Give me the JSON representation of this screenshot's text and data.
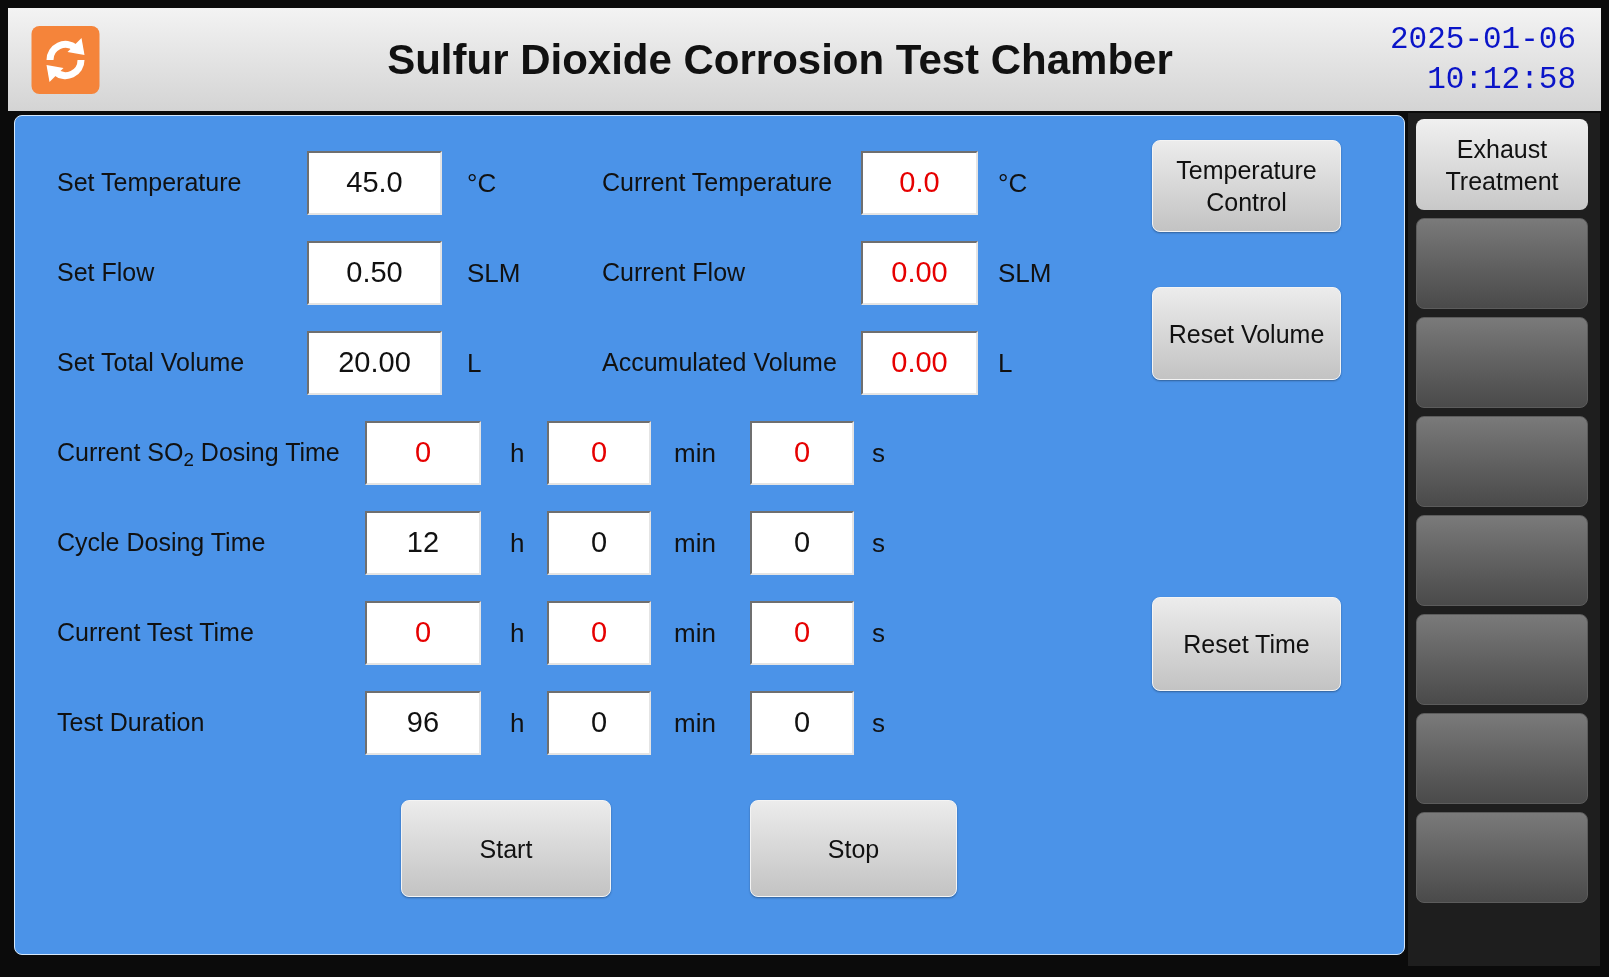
{
  "header": {
    "title": "Sulfur Dioxide Corrosion Test Chamber",
    "date": "2025-01-06",
    "time": "10:12:58"
  },
  "parameter_rows": [
    {
      "setpoint": {
        "label": "Set Temperature",
        "value": "45.0",
        "unit": "°C"
      },
      "reading": {
        "label": "Current Temperature",
        "value": "0.0",
        "unit": "°C"
      }
    },
    {
      "setpoint": {
        "label": "Set Flow",
        "value": "0.50",
        "unit": "SLM"
      },
      "reading": {
        "label": "Current Flow",
        "value": "0.00",
        "unit": "SLM"
      }
    },
    {
      "setpoint": {
        "label": "Set Total Volume",
        "value": "20.00",
        "unit": "L"
      },
      "reading": {
        "label": "Accumulated Volume",
        "value": "0.00",
        "unit": "L"
      }
    }
  ],
  "time_rows": [
    {
      "label": "Current SO$_{2}$ Dosing Time",
      "kind": "reading",
      "fields": [
        {
          "value": "0",
          "unit": "h"
        },
        {
          "value": "0",
          "unit": "min"
        },
        {
          "value": "0",
          "unit": "s"
        }
      ]
    },
    {
      "label": "Cycle Dosing Time",
      "kind": "setpoint",
      "fields": [
        {
          "value": "12",
          "unit": "h"
        },
        {
          "value": "0",
          "unit": "min"
        },
        {
          "value": "0",
          "unit": "s"
        }
      ]
    },
    {
      "label": "Current Test Time",
      "kind": "reading",
      "fields": [
        {
          "value": "0",
          "unit": "h"
        },
        {
          "value": "0",
          "unit": "min"
        },
        {
          "value": "0",
          "unit": "s"
        }
      ]
    },
    {
      "label": "Test Duration",
      "kind": "setpoint",
      "fields": [
        {
          "value": "96",
          "unit": "h"
        },
        {
          "value": "0",
          "unit": "min"
        },
        {
          "value": "0",
          "unit": "s"
        }
      ]
    }
  ],
  "control_buttons": [
    {
      "label": "Temperature Control"
    },
    {
      "label": "Reset Volume"
    },
    {
      "label": "Reset Time"
    }
  ],
  "action_buttons": [
    {
      "label": "Start"
    },
    {
      "label": "Stop"
    }
  ],
  "sidebar": {
    "buttons": [
      {
        "kind": "labeled",
        "label": "Exhaust Treatment"
      },
      {
        "kind": "blank"
      },
      {
        "kind": "blank"
      },
      {
        "kind": "blank"
      },
      {
        "kind": "blank"
      },
      {
        "kind": "blank"
      },
      {
        "kind": "blank"
      },
      {
        "kind": "blank"
      }
    ]
  }
}
